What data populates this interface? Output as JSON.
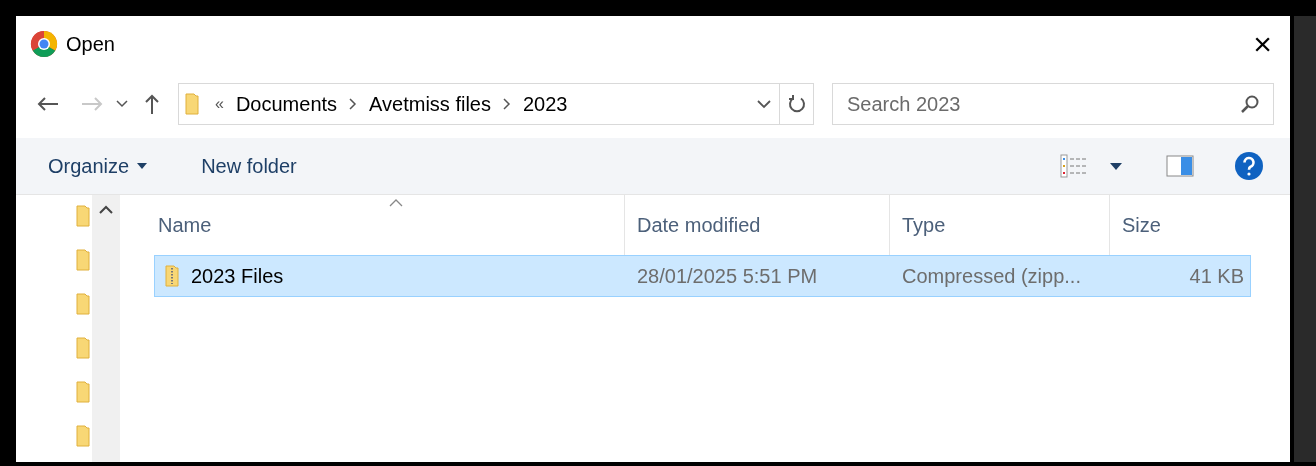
{
  "window": {
    "title": "Open",
    "close": "×"
  },
  "address": {
    "overflow": "«",
    "segments": [
      "Documents",
      "Avetmiss files",
      "2023"
    ]
  },
  "search": {
    "placeholder": "Search 2023"
  },
  "toolbar": {
    "organize": "Organize",
    "new_folder": "New folder"
  },
  "columns": [
    {
      "label": "Name",
      "sorted": true
    },
    {
      "label": "Date modified",
      "sorted": false
    },
    {
      "label": "Type",
      "sorted": false
    },
    {
      "label": "Size",
      "sorted": false
    }
  ],
  "rows": [
    {
      "name": "2023 Files",
      "date": "28/01/2025 5:51 PM",
      "type": "Compressed (zipp...",
      "size": "41 KB",
      "selected": true
    }
  ]
}
